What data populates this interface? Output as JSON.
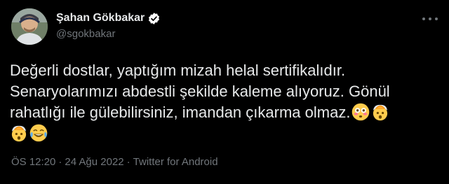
{
  "author": {
    "display_name": "Şahan Gökbakar",
    "handle": "@sgokbakar",
    "verified": true
  },
  "tweet": {
    "lines": [
      "Değerli dostlar, yaptığım mizah helal sertifikalıdır.",
      "Senaryolarımızı abdestli şekilde kaleme alıyoruz. Gönül",
      "rahatlığı ile gülebilirsiniz, imandan çıkarma olmaz."
    ],
    "emojis_line3": [
      "flushed-face-icon",
      "exploding-head-icon"
    ],
    "emojis_line4": [
      "exploding-head-icon",
      "face-with-tears-of-joy-icon"
    ]
  },
  "meta": {
    "time": "ÖS 12:20",
    "date": "24 Ağu 2022",
    "separator": "·",
    "source": "Twitter for Android"
  },
  "colors": {
    "background": "#000000",
    "text_primary": "#e7e9ea",
    "text_secondary": "#71767b",
    "verified_badge": "#ffffff"
  }
}
